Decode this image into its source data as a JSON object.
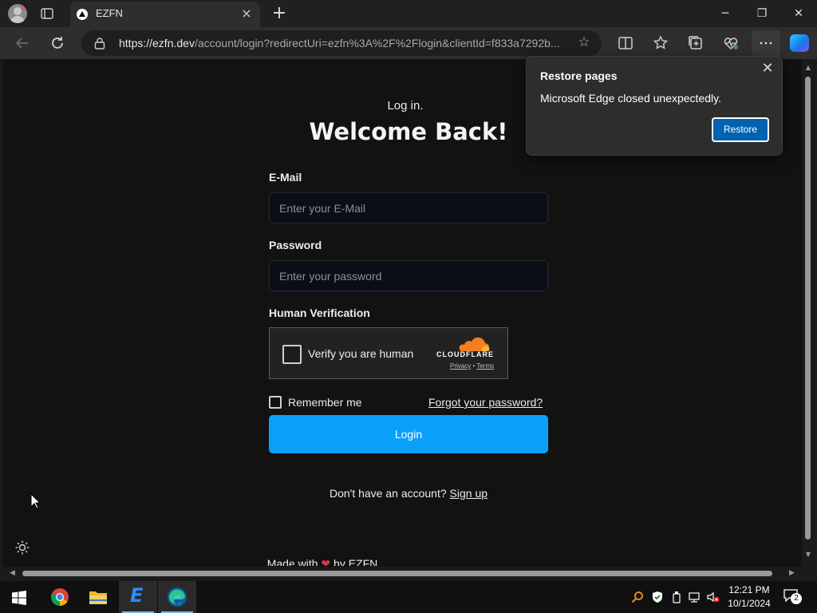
{
  "browser": {
    "tab": {
      "title": "EZFN",
      "close_icon": "×"
    },
    "new_tab_label": "+",
    "window_controls": {
      "minimize": "─",
      "maximize": "❐",
      "close": "✕"
    },
    "address": {
      "url_domain": "https://ezfn.dev",
      "url_rest": "/account/login?redirectUri=ezfn%3A%2F%2Flogin&clientId=f833a7292b..."
    }
  },
  "page": {
    "subtitle": "Log in.",
    "title": "Welcome Back!",
    "email": {
      "label": "E-Mail",
      "placeholder": "Enter your E-Mail"
    },
    "password": {
      "label": "Password",
      "placeholder": "Enter your password"
    },
    "verification": {
      "label": "Human Verification",
      "checkbox_text": "Verify you are human",
      "brand": "CLOUDFLARE",
      "privacy": "Privacy",
      "separator": "•",
      "terms": "Terms"
    },
    "remember_label": "Remember me",
    "forgot_label": "Forgot your password?",
    "login_label": "Login",
    "signup_prompt": "Don't have an account?",
    "signup_link": "Sign up",
    "footer_before": "Made with",
    "footer_after": "by EZFN"
  },
  "popup": {
    "title": "Restore pages",
    "message": "Microsoft Edge closed unexpectedly.",
    "restore_label": "Restore"
  },
  "taskbar": {
    "time": "12:21 PM",
    "date": "10/1/2024",
    "notification_count": "2"
  },
  "colors": {
    "accent": "#0ba0fa",
    "page_bg": "#121212",
    "restore_button": "#0063b1",
    "cloudflare_orange": "#f38020"
  }
}
